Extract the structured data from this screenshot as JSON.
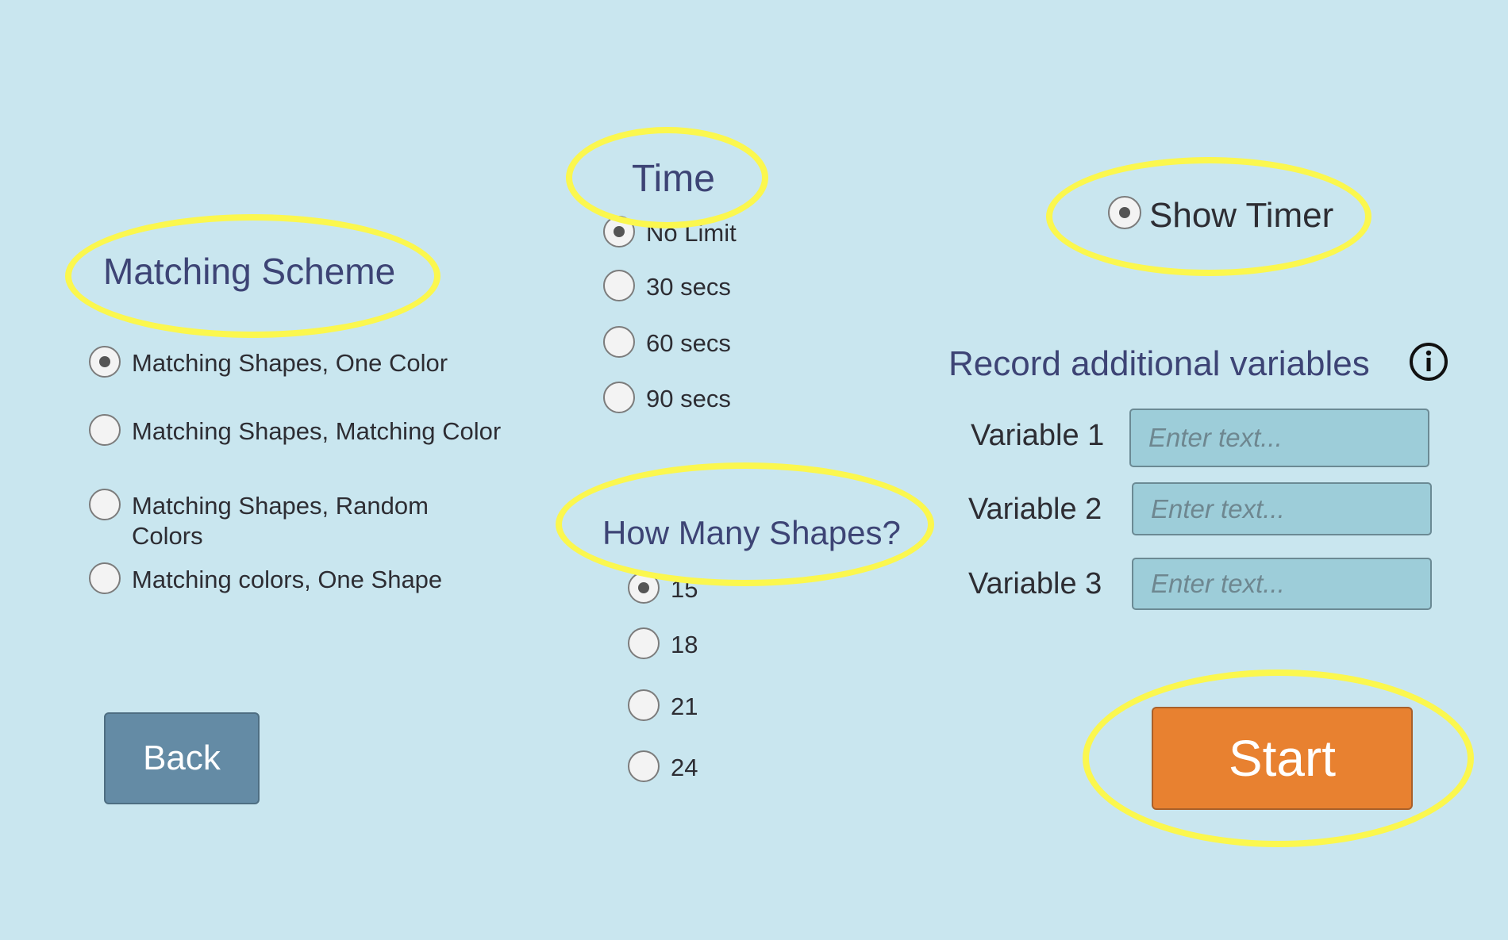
{
  "matching_scheme": {
    "title": "Matching Scheme",
    "options": [
      {
        "label": "Matching Shapes, One Color",
        "selected": true
      },
      {
        "label": "Matching Shapes, Matching Color",
        "selected": false
      },
      {
        "label": "Matching Shapes, Random Colors",
        "selected": false
      },
      {
        "label": "Matching colors, One Shape",
        "selected": false
      }
    ]
  },
  "time": {
    "title": "Time",
    "options": [
      {
        "label": "No Limit",
        "selected": true
      },
      {
        "label": "30 secs",
        "selected": false
      },
      {
        "label": "60 secs",
        "selected": false
      },
      {
        "label": "90 secs",
        "selected": false
      }
    ]
  },
  "shapes": {
    "title": "How Many Shapes?",
    "options": [
      {
        "label": "15",
        "selected": true
      },
      {
        "label": "18",
        "selected": false
      },
      {
        "label": "21",
        "selected": false
      },
      {
        "label": "24",
        "selected": false
      }
    ]
  },
  "show_timer": {
    "label": "Show Timer",
    "selected": true
  },
  "variables": {
    "title": "Record additional variables",
    "info_icon": "info-icon",
    "fields": [
      {
        "label": "Variable 1",
        "value": "",
        "placeholder": "Enter text..."
      },
      {
        "label": "Variable 2",
        "value": "",
        "placeholder": "Enter text..."
      },
      {
        "label": "Variable 3",
        "value": "",
        "placeholder": "Enter text..."
      }
    ]
  },
  "buttons": {
    "back": "Back",
    "start": "Start"
  },
  "colors": {
    "background": "#c9e6ef",
    "heading": "#3d4475",
    "highlight": "#fbf74e",
    "back_button": "#648ba5",
    "start_button": "#e88130",
    "input_background": "#9dcdd9"
  }
}
